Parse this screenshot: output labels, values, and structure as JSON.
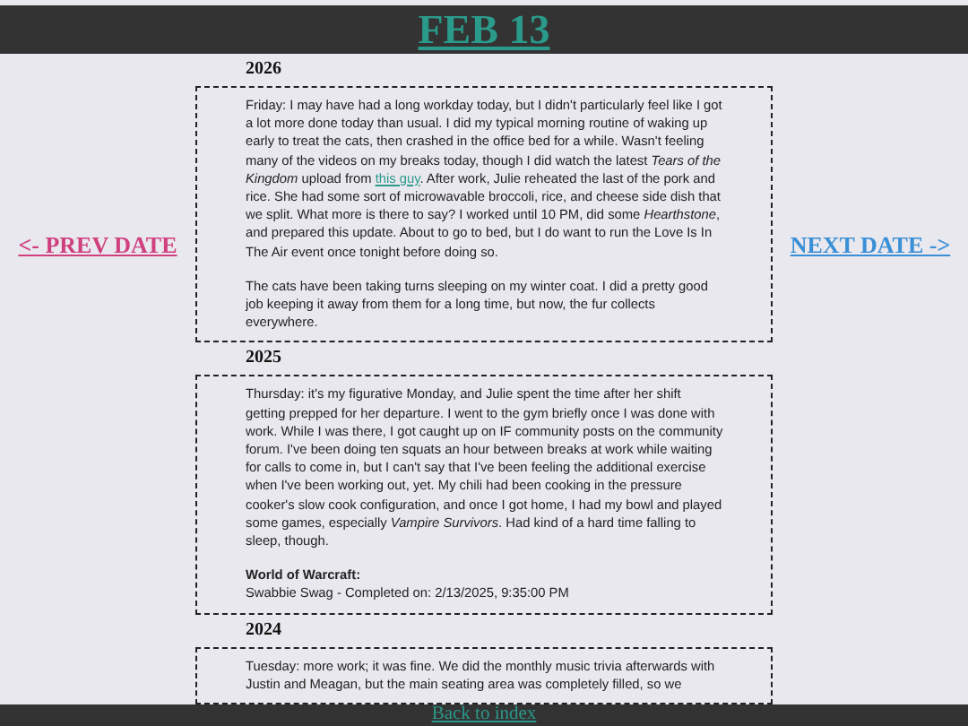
{
  "title": "FEB 13",
  "prev_link": "<- PREV DATE",
  "next_link": "NEXT DATE ->",
  "entries": [
    {
      "year": "2026",
      "blocks": [
        {
          "kind": "paragraph",
          "parts": [
            {
              "kind": "text",
              "text": "Friday: I may have had a long workday today, but I didn't particularly feel like I got a lot more done today than usual. I did my typical morning routine of waking up early to treat the cats, then crashed in the office bed for a while. Wasn't feeling many of the videos on my breaks today, though I did watch the latest *Tears of the Kingdom* upload from "
            },
            {
              "kind": "link",
              "text": "this guy"
            },
            {
              "kind": "text",
              "text": ". After work, Julie reheated the last of the pork and rice. She had some sort of microwavable broccoli, rice, and cheese side dish that we split. What more is there to say? I worked until 10 PM, did some *Hearthstone*, and prepared this update. About to go to bed, but I do want to run the Love Is In The Air event once tonight before doing so."
            }
          ]
        },
        {
          "kind": "paragraph",
          "parts": [
            {
              "kind": "text",
              "text": "The cats have been taking turns sleeping on my winter coat. I did a pretty good job keeping it away from them for a long time, but now, the fur collects everywhere."
            }
          ]
        }
      ]
    },
    {
      "year": "2025",
      "blocks": [
        {
          "kind": "paragraph",
          "parts": [
            {
              "kind": "text",
              "text": "Thursday: it's my figurative Monday, and Julie spent the time after her shift getting prepped for her departure. I went to the gym briefly once I was done with work. While I was there, I got caught up on IF community posts on the community forum. I've been doing ten squats an hour between breaks at work while waiting for calls to come in, but I can't say that I've been feeling the additional exercise when I've been working out, yet. My chili had been cooking in the pressure cooker's slow cook configuration, and once I got home, I had my bowl and played some games, especially *Vampire Survivors*. Had kind of a hard time falling to sleep, though."
            }
          ]
        },
        {
          "kind": "achievement",
          "heading": "World of Warcraft:",
          "text": "Swabbie Swag - Completed on: 2/13/2025, 9:35:00 PM"
        }
      ]
    },
    {
      "year": "2024",
      "blocks": [
        {
          "kind": "paragraph",
          "parts": [
            {
              "kind": "text",
              "text": "Tuesday: more work; it was fine. We did the monthly music trivia afterwards with Justin and Meagan, but the main seating area was completely filled, so we"
            }
          ]
        }
      ]
    }
  ],
  "footer_link": "Back to index"
}
